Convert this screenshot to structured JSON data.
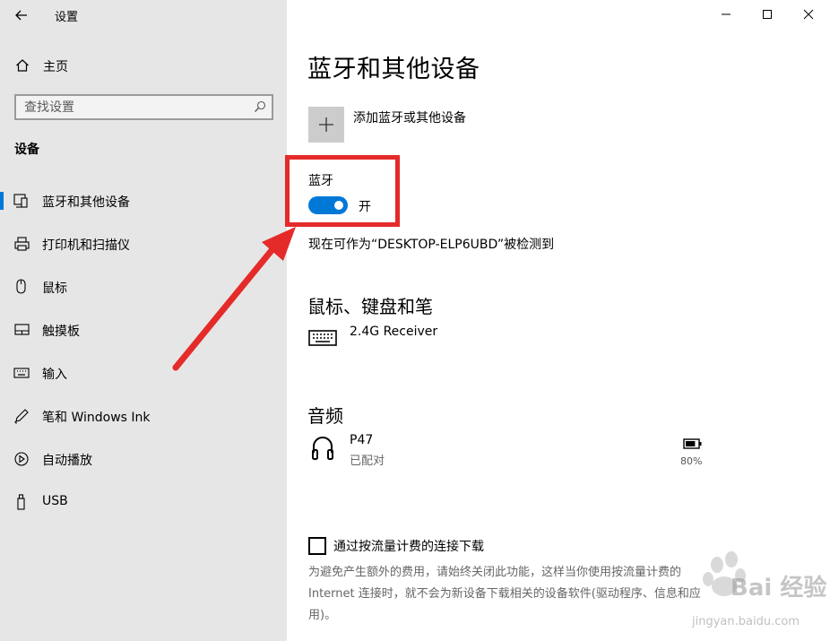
{
  "window": {
    "title": "设置",
    "controls": [
      "minimize",
      "maximize",
      "close"
    ]
  },
  "sidebar": {
    "home_label": "主页",
    "search_placeholder": "查找设置",
    "section_heading": "设备",
    "items": [
      {
        "label": "蓝牙和其他设备",
        "icon": "bluetooth-devices-icon",
        "active": true
      },
      {
        "label": "打印机和扫描仪",
        "icon": "printer-icon",
        "active": false
      },
      {
        "label": "鼠标",
        "icon": "mouse-icon",
        "active": false
      },
      {
        "label": "触摸板",
        "icon": "touchpad-icon",
        "active": false
      },
      {
        "label": "输入",
        "icon": "keyboard-icon",
        "active": false
      },
      {
        "label": "笔和 Windows Ink",
        "icon": "pen-icon",
        "active": false
      },
      {
        "label": "自动播放",
        "icon": "autoplay-icon",
        "active": false
      },
      {
        "label": "USB",
        "icon": "usb-icon",
        "active": false
      }
    ]
  },
  "main": {
    "title": "蓝牙和其他设备",
    "add_device_label": "添加蓝牙或其他设备",
    "bluetooth": {
      "label": "蓝牙",
      "toggle_state": "开",
      "enabled": true
    },
    "discoverable_text": "现在可作为“DESKTOP-ELP6UBD”被检测到",
    "sections": [
      {
        "heading": "鼠标、键盘和笔",
        "devices": [
          {
            "name": "2.4G Receiver",
            "status": "",
            "icon": "keyboard-icon"
          }
        ]
      },
      {
        "heading": "音频",
        "devices": [
          {
            "name": "P47",
            "status": "已配对",
            "icon": "headphones-icon",
            "battery": "80%",
            "battery_level": 0.8
          }
        ]
      }
    ],
    "metered": {
      "label": "通过按流量计费的连接下载",
      "checked": false,
      "description": "为避免产生额外的费用，请始终关闭此功能，这样当你使用按流量计费的 Internet 连接时，就不会为新设备下载相关的设备软件(驱动程序、信息和应用)。"
    }
  },
  "colors": {
    "accent": "#0078d7",
    "sidebar_bg": "#e6e6e6",
    "annotation": "#e52a2a"
  },
  "watermark": {
    "text": "Bai 经验",
    "url_text": "jingyan.baidu.com"
  }
}
